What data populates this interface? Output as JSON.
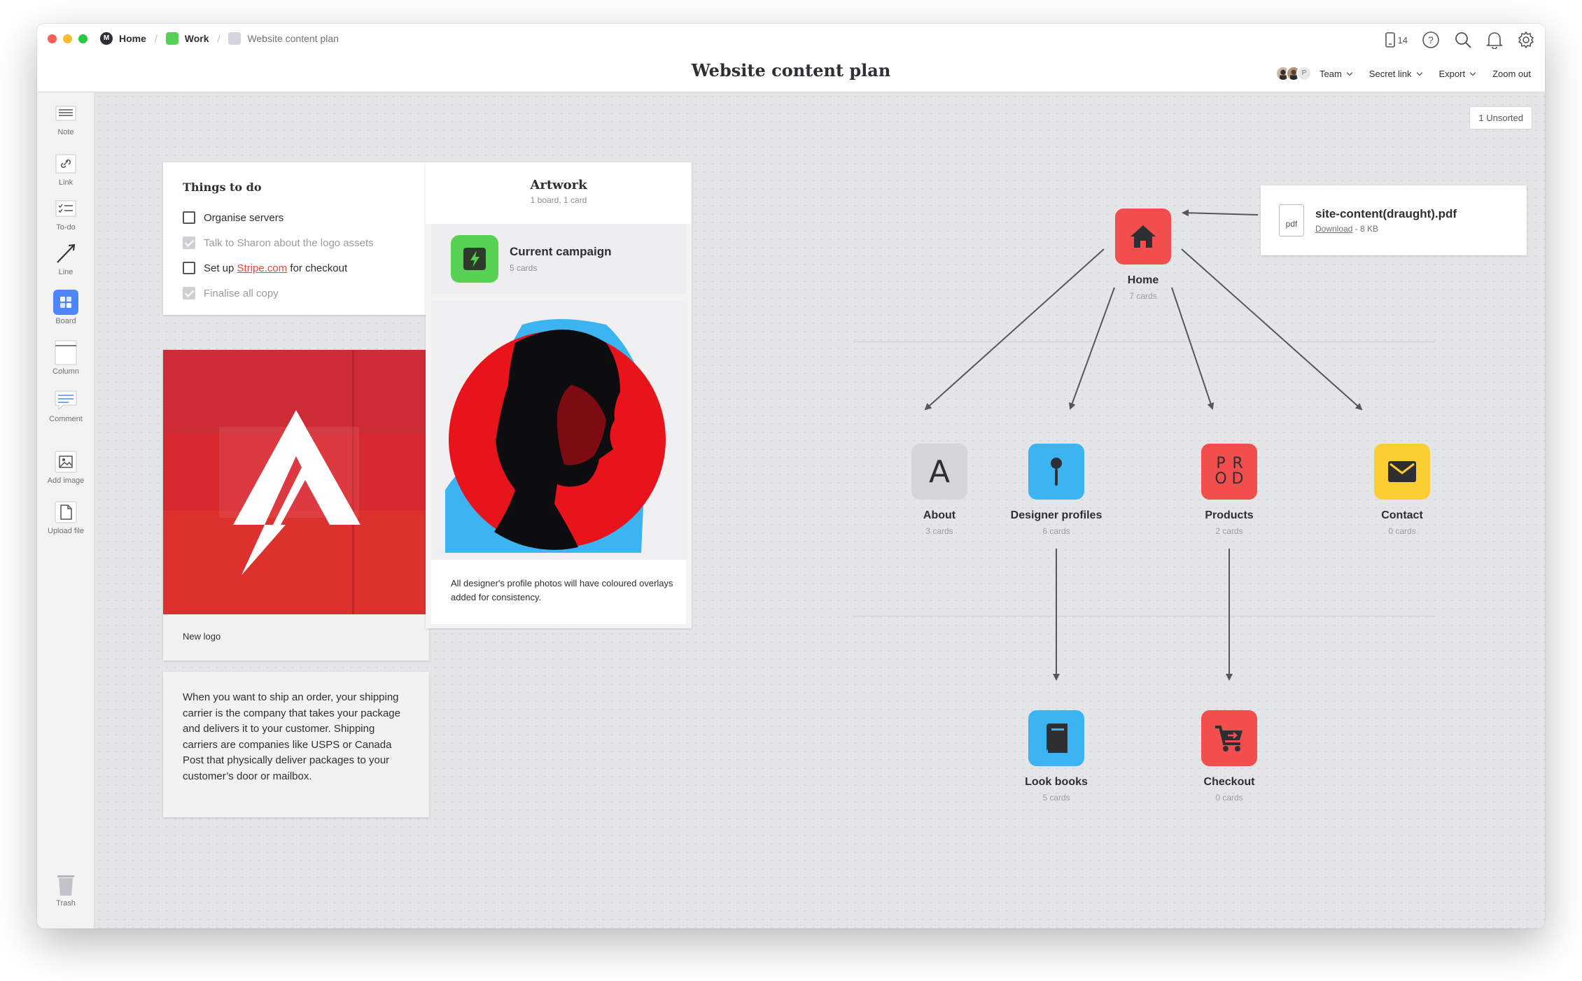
{
  "window": {
    "breadcrumb": [
      "Home",
      "Work",
      "Website content plan"
    ],
    "title": "Website content plan",
    "device_count": "14",
    "menu": [
      "Team",
      "Secret link",
      "Export",
      "Zoom out"
    ],
    "avatar_initial": "P",
    "colors": {
      "close": "#fc5f57",
      "minimize": "#fdbc2e",
      "zoom": "#28c840",
      "work": "#57d154",
      "website": "#d4d5d8"
    }
  },
  "sidebar": {
    "tools": [
      "Note",
      "Link",
      "To-do",
      "Line",
      "Board",
      "Column",
      "Comment",
      "Add image",
      "Upload file"
    ],
    "trash": "Trash"
  },
  "canvas": {
    "unsorted": "1 Unsorted",
    "todo": {
      "title": "Things to do",
      "items": [
        {
          "text": "Organise servers",
          "done": false
        },
        {
          "text": "Talk to Sharon about the logo assets",
          "done": true
        },
        {
          "pre": "Set up ",
          "link": "Stripe.com",
          "post": " for checkout",
          "done": false
        },
        {
          "text": "Finalise all copy",
          "done": true
        }
      ]
    },
    "logo_card": {
      "caption": "New logo"
    },
    "note": "When you want to ship an order, your shipping carrier is the company that takes your package and delivers it to your customer. Shipping carriers are companies like USPS or Canada Post that physically deliver packages to your customer’s door or mailbox.",
    "artwork": {
      "title": "Artwork",
      "sub": "1 board, 1 card",
      "campaign_title": "Current campaign",
      "campaign_sub": "5 cards",
      "caption": "All designer's profile photos will have coloured overlays added for consistency."
    },
    "pdf": {
      "name": "site-content(draught).pdf",
      "icon": "pdf",
      "download": "Download",
      "size": " - 8 KB"
    },
    "nodes": {
      "home": {
        "title": "Home",
        "sub": "7 cards",
        "color": "#f24e4e"
      },
      "about": {
        "title": "About",
        "sub": "3 cards",
        "letter": "A",
        "color": "#d5d6d9"
      },
      "designers": {
        "title": "Designer profiles",
        "sub": "6 cards",
        "color": "#3db4f2"
      },
      "products": {
        "title": "Products",
        "sub": "2 cards",
        "color": "#f24e4e",
        "mark": [
          "P",
          "R",
          "O",
          "D"
        ]
      },
      "contact": {
        "title": "Contact",
        "sub": "0 cards",
        "color": "#fbcf33"
      },
      "lookbooks": {
        "title": "Look books",
        "sub": "5 cards",
        "color": "#3db4f2"
      },
      "checkout": {
        "title": "Checkout",
        "sub": "0 cards",
        "color": "#f24e4e"
      }
    }
  }
}
